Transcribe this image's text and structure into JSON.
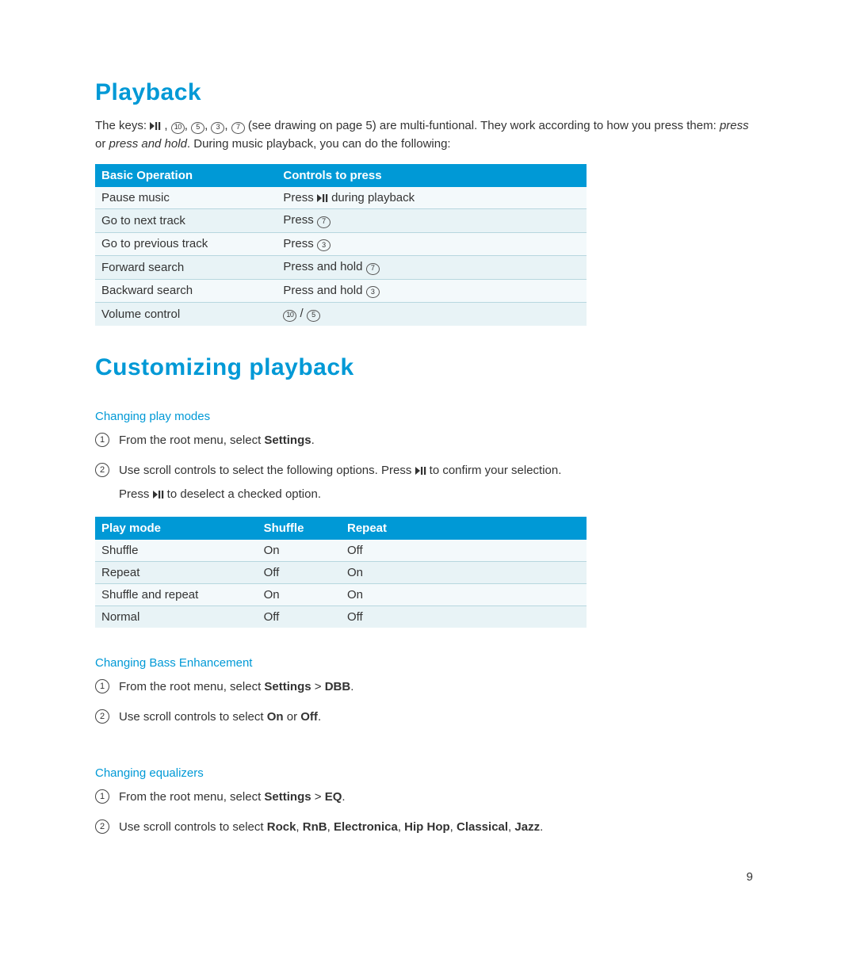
{
  "page_number": "9",
  "section1": {
    "title": "Playback",
    "intro_before": "The keys: ",
    "keys": [
      "play-pause",
      "10",
      "5",
      "3",
      "7"
    ],
    "intro_after_keys": " (see drawing on page 5) are multi-funtional. They work according to how you press them: ",
    "press_italic": "press",
    "or_word": " or ",
    "press_hold_italic": "press and hold",
    "intro_tail": ".  During music playback, you can do the following:",
    "table": {
      "headers": [
        "Basic Operation",
        "Controls to press"
      ],
      "rows": [
        {
          "op": "Pause music",
          "ctrl_prefix": "Press ",
          "key_icon": "play-pause",
          "ctrl_suffix": " during playback"
        },
        {
          "op": "Go to next track",
          "ctrl_prefix": "Press ",
          "key_icon": "7",
          "ctrl_suffix": ""
        },
        {
          "op": "Go to previous track",
          "ctrl_prefix": "Press ",
          "key_icon": "3",
          "ctrl_suffix": ""
        },
        {
          "op": "Forward search",
          "ctrl_prefix": "Press and hold ",
          "key_icon": "7",
          "ctrl_suffix": ""
        },
        {
          "op": "Backward search",
          "ctrl_prefix": "Press and hold ",
          "key_icon": "3",
          "ctrl_suffix": ""
        },
        {
          "op": "Volume control",
          "ctrl_prefix": "",
          "key_icon": "10",
          "key_icon2": "5",
          "sep": " / ",
          "ctrl_suffix": ""
        }
      ]
    }
  },
  "section2": {
    "title": "Customizing playback",
    "sub1": {
      "heading": "Changing play modes",
      "step1_before": "From the root menu, select ",
      "step1_bold": "Settings",
      "step1_after": ".",
      "step2_before": "Use scroll controls to select the following options. Press ",
      "step2_after": " to confirm your selection.",
      "step2_line2_before": "Press ",
      "step2_line2_after": " to deselect a checked option.",
      "table": {
        "headers": [
          "Play mode",
          "Shuffle",
          "Repeat"
        ],
        "rows": [
          [
            "Shuffle",
            "On",
            "Off"
          ],
          [
            "Repeat",
            "Off",
            "On"
          ],
          [
            "Shuffle and repeat",
            "On",
            "On"
          ],
          [
            "Normal",
            "Off",
            "Off"
          ]
        ]
      }
    },
    "sub2": {
      "heading": "Changing Bass Enhancement",
      "step1_before": "From the root menu, select ",
      "step1_bold1": "Settings",
      "step1_gt": " > ",
      "step1_bold2": "DBB",
      "step1_after": ".",
      "step2_before": "Use scroll controls to select ",
      "step2_bold1": "On",
      "step2_or": " or ",
      "step2_bold2": "Off",
      "step2_after": "."
    },
    "sub3": {
      "heading": "Changing equalizers",
      "step1_before": "From the root menu, select ",
      "step1_bold1": "Settings",
      "step1_gt": " > ",
      "step1_bold2": "EQ",
      "step1_after": ".",
      "step2_before": "Use scroll controls to select ",
      "step2_b1": "Rock",
      "step2_b2": "RnB",
      "step2_b3": "Electronica",
      "step2_b4": "Hip Hop",
      "step2_b5": "Classical",
      "step2_b6": "Jazz",
      "comma": ", ",
      "step2_after": "."
    }
  }
}
